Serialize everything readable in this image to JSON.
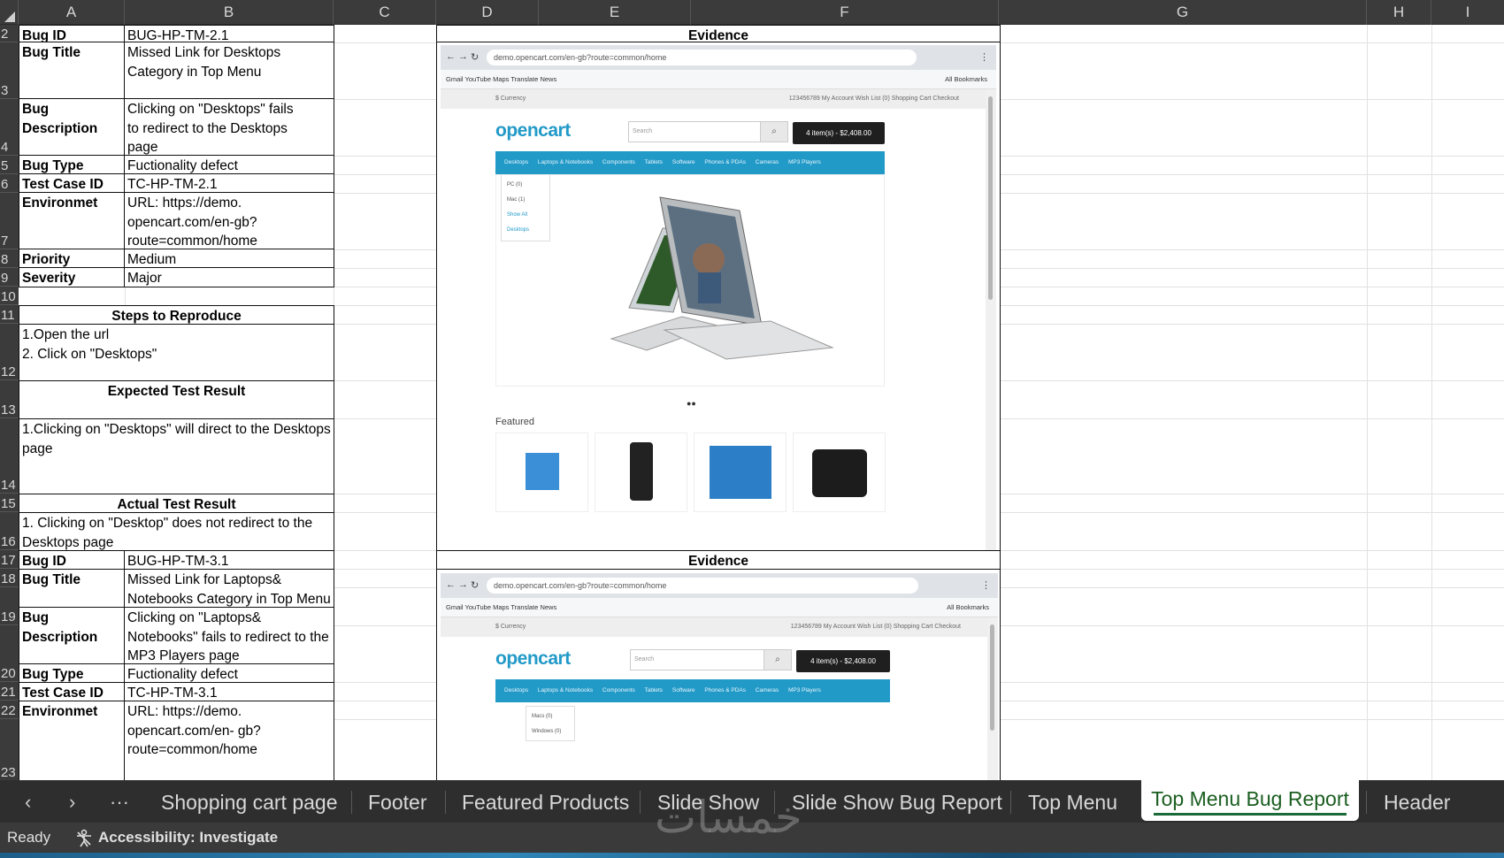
{
  "columns": [
    "A",
    "B",
    "C",
    "D",
    "E",
    "F",
    "G",
    "H",
    "I"
  ],
  "rows": [
    "2",
    "3",
    "4",
    "5",
    "6",
    "7",
    "8",
    "9",
    "10",
    "11",
    "12",
    "13",
    "14",
    "15",
    "16",
    "17",
    "18",
    "19",
    "20",
    "21",
    "22",
    "23"
  ],
  "report1": {
    "bug_id_label": "Bug ID",
    "bug_id": "BUG-HP-TM-2.1",
    "bug_title_label": "Bug Title",
    "bug_title": "Missed Link for Desktops Category in Top Menu",
    "bug_desc_label": "Bug Description",
    "bug_desc": "Clicking on \"Desktops\" fails to redirect to the Desktops page",
    "bug_type_label": "Bug Type",
    "bug_type": "Fuctionality defect",
    "test_case_label": "Test Case ID",
    "test_case": "TC-HP-TM-2.1",
    "env_label": "Environmet",
    "env": "URL: https://demo. opencart.com/en-gb?route=common/home",
    "priority_label": "Priority",
    "priority": "Medium",
    "severity_label": "Severity",
    "severity": "Major",
    "steps_header": "Steps to Reproduce",
    "step1": "1.Open the url",
    "step2": "2. Click on \"Desktops\"",
    "expected_header": "Expected Test Result",
    "expected": "1.Clicking on \"Desktops\" will direct to the Desktops page",
    "actual_header": "Actual Test Result",
    "actual": "1. Clicking on \"Desktop\" does not redirect to the Desktops page",
    "evidence_header": "Evidence"
  },
  "report2": {
    "bug_id_label": "Bug ID",
    "bug_id": "BUG-HP-TM-3.1",
    "bug_title_label": "Bug Title",
    "bug_title": "Missed Link for Laptops& Notebooks Category in Top Menu",
    "bug_desc_label": "Bug Description",
    "bug_desc": "Clicking on \"Laptops& Notebooks\" fails to redirect to the MP3 Players page",
    "bug_type_label": "Bug Type",
    "bug_type": "Fuctionality defect",
    "test_case_label": "Test Case ID",
    "test_case": "TC-HP-TM-3.1",
    "env_label": "Environmet",
    "env": "URL: https://demo. opencart.com/en- gb?route=common/home",
    "evidence_header": "Evidence"
  },
  "evidence": {
    "url": "demo.opencart.com/en-gb?route=common/home",
    "bookmarks": "Gmail   YouTube   Maps   Translate   News",
    "all_bookmarks": "All Bookmarks",
    "currency": "$ Currency",
    "top_links": "123456789   My Account   Wish List (0)   Shopping Cart   Checkout",
    "logo": "opencart",
    "search_placeholder": "Search",
    "cart": "4 item(s) - $2,408.00",
    "menu": [
      "Desktops",
      "Laptops & Notebooks",
      "Components",
      "Tablets",
      "Software",
      "Phones & PDAs",
      "Cameras",
      "MP3 Players"
    ],
    "dropdown1": [
      "PC (0)",
      "Mac (1)",
      "Show All Desktops"
    ],
    "dropdown2": [
      "Macs (0)",
      "Windows (0)"
    ],
    "featured": "Featured"
  },
  "tabs": [
    "Shopping cart page",
    "Footer",
    "Featured Products",
    "Slide Show",
    "Slide Show Bug Report",
    "Top Menu",
    "Top Menu Bug Report",
    "Header"
  ],
  "active_tab": "Top Menu Bug Report",
  "status": {
    "ready": "Ready",
    "accessibility": "Accessibility: Investigate"
  },
  "watermark": "خمسات"
}
